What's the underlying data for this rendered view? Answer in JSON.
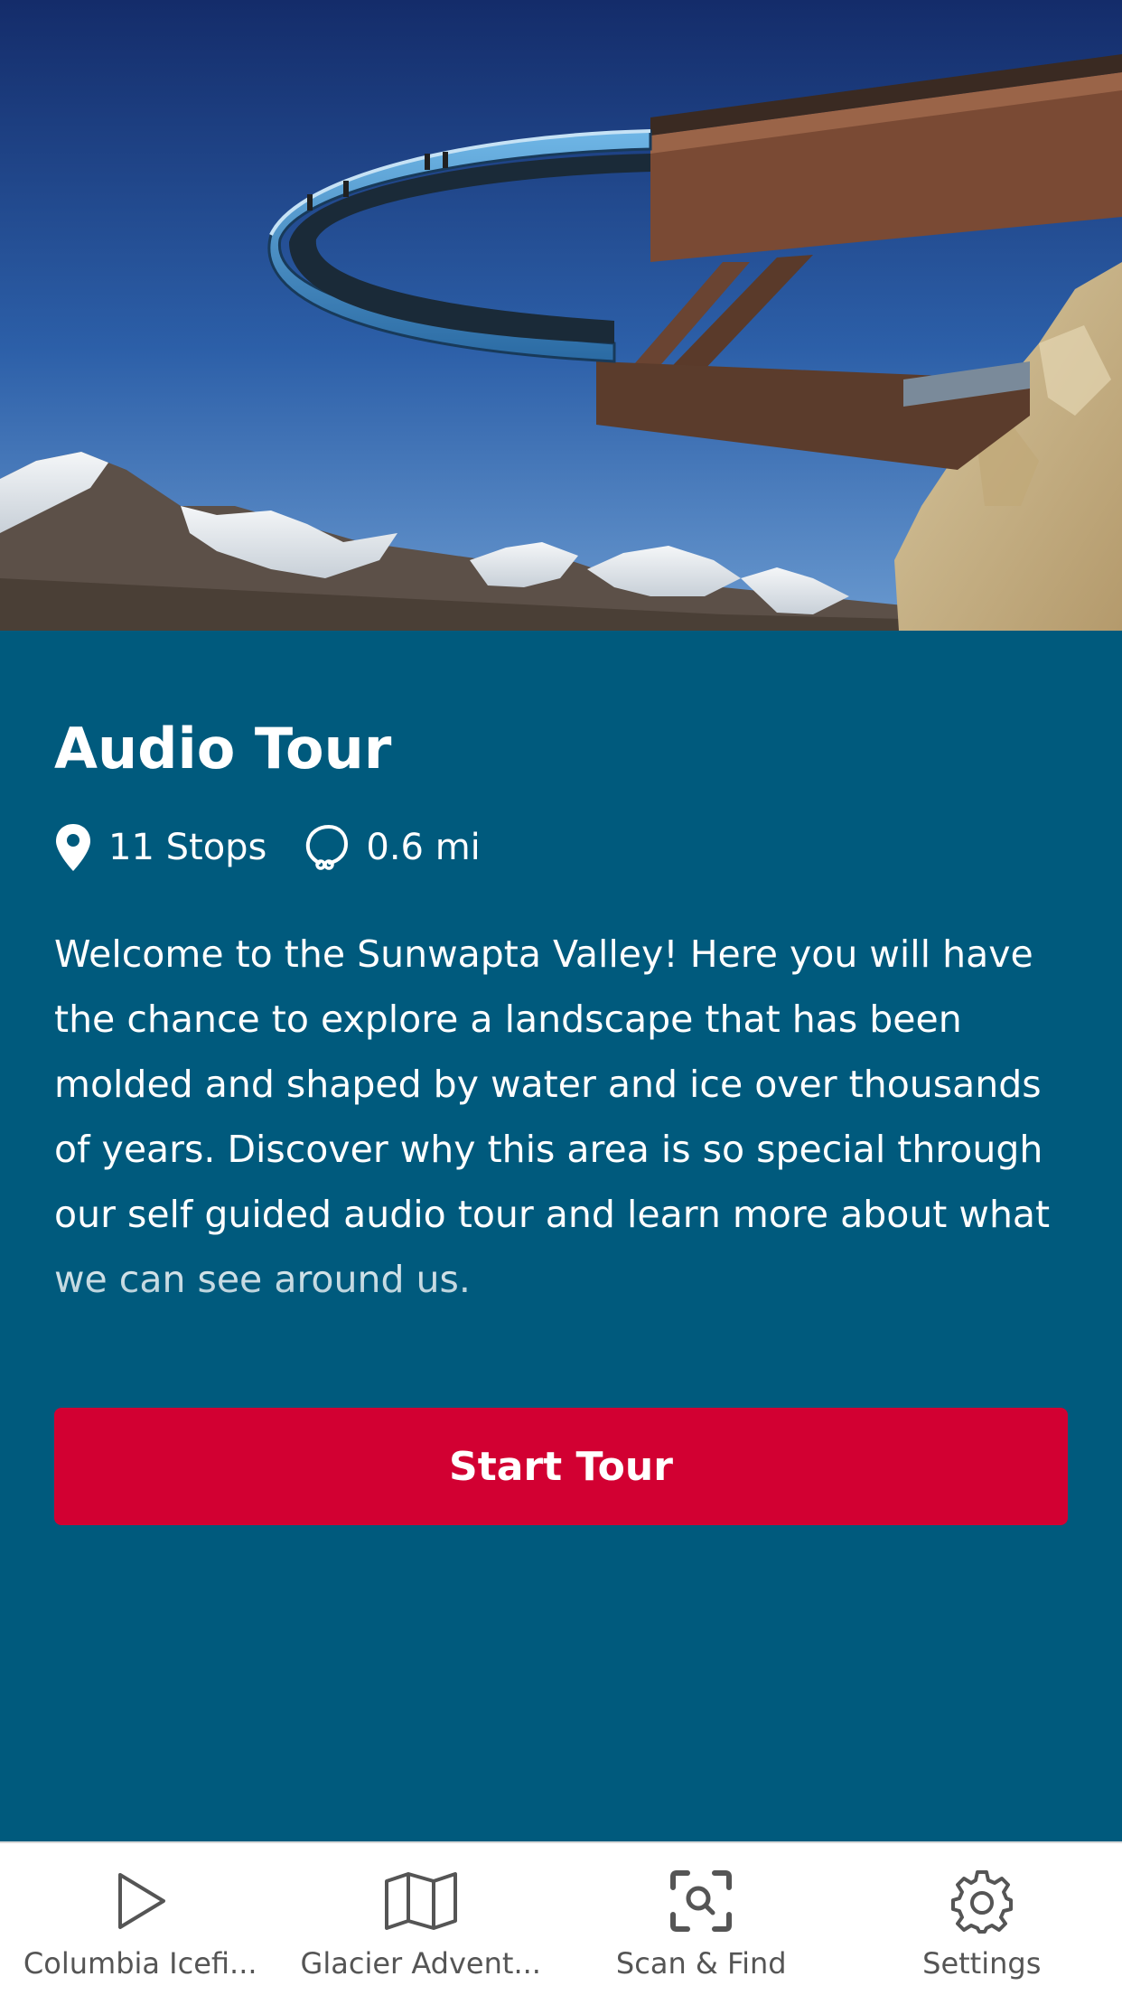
{
  "hero": {
    "image_name": "skywalk-glass-walkway-photo"
  },
  "tour": {
    "title": "Audio Tour",
    "stops_label": "11 Stops",
    "distance_label": "0.6 mi",
    "description": "Welcome to the Sunwapta Valley! Here you will have the chance to explore a landscape that has been molded and shaped by water and ice over thousands of years. Discover why this area is so special through our self guided audio tour and learn more about what we can see around us.",
    "start_label": "Start Tour"
  },
  "tabs": [
    {
      "label": "Columbia Icefi...",
      "icon": "play-icon"
    },
    {
      "label": "Glacier Advent...",
      "icon": "map-icon"
    },
    {
      "label": "Scan & Find",
      "icon": "scan-icon"
    },
    {
      "label": "Settings",
      "icon": "gear-icon"
    }
  ],
  "colors": {
    "background": "#005a7d",
    "accent": "#d20032",
    "tab_bar": "#ffffff",
    "tab_text": "#555555"
  }
}
